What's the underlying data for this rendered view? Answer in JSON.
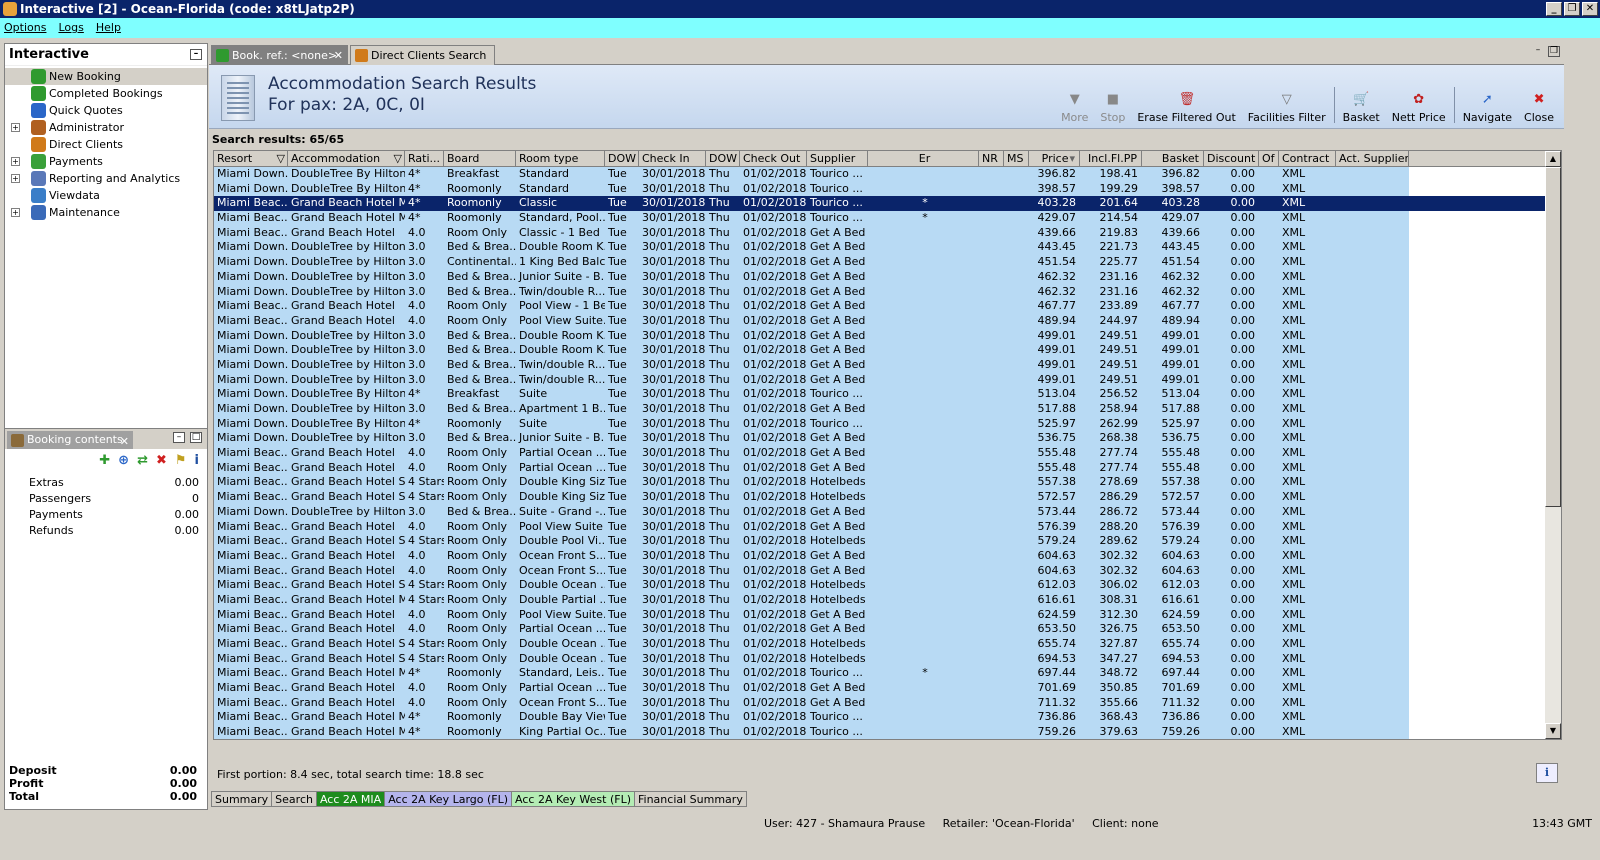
{
  "window": {
    "title": "Interactive [2] - Ocean-Florida (code: x8tLJatp2P)",
    "minimize_icon": "_",
    "restore_icon": "❐",
    "close_icon": "✕"
  },
  "menu": [
    "Options",
    "Logs",
    "Help"
  ],
  "left_panel": {
    "title": "Interactive",
    "items": [
      {
        "label": "New Booking",
        "color": "#2f9a2f",
        "expandable": false,
        "selected": true
      },
      {
        "label": "Completed Bookings",
        "color": "#2f9a2f",
        "expandable": false,
        "selected": false
      },
      {
        "label": "Quick Quotes",
        "color": "#2a66c8",
        "expandable": false,
        "selected": false
      },
      {
        "label": "Administrator",
        "color": "#b06020",
        "expandable": true,
        "selected": false
      },
      {
        "label": "Direct Clients",
        "color": "#d07a1a",
        "expandable": false,
        "selected": false
      },
      {
        "label": "Payments",
        "color": "#3aa03a",
        "expandable": true,
        "selected": false
      },
      {
        "label": "Reporting and Analytics",
        "color": "#5a78b8",
        "expandable": true,
        "selected": false
      },
      {
        "label": "Viewdata",
        "color": "#3a7ec8",
        "expandable": false,
        "selected": false
      },
      {
        "label": "Maintenance",
        "color": "#3a6ab8",
        "expandable": true,
        "selected": false
      }
    ]
  },
  "booking_contents": {
    "tab_label": "Booking contents",
    "tools": [
      "✚",
      "⊕",
      "⇄",
      "✖",
      "⚑",
      "i"
    ],
    "rows": [
      {
        "label": "Extras",
        "value": "0.00"
      },
      {
        "label": "Passengers",
        "value": "0"
      },
      {
        "label": "Payments",
        "value": "0.00"
      },
      {
        "label": "Refunds",
        "value": "0.00"
      }
    ],
    "totals": [
      {
        "label": "Deposit",
        "value": "0.00"
      },
      {
        "label": "Profit",
        "value": "0.00"
      },
      {
        "label": "Total",
        "value": "0.00"
      }
    ]
  },
  "tabs": [
    {
      "label": "Book. ref.: <none>",
      "active": true
    },
    {
      "label": "Direct Clients Search",
      "active": false
    }
  ],
  "header": {
    "title": "Accommodation Search Results",
    "subtitle": "For pax: 2A, 0C, 0I"
  },
  "toolbar": [
    {
      "label": "More",
      "icon": "▼",
      "disabled": true,
      "color": "#888"
    },
    {
      "label": "Stop",
      "icon": "■",
      "disabled": true,
      "color": "#888"
    },
    {
      "label": "Erase Filtered Out",
      "icon": "🗑",
      "disabled": false,
      "color": "#c03030"
    },
    {
      "label": "Facilities Filter",
      "icon": "▽",
      "disabled": false,
      "color": "#777"
    },
    {
      "label": "Basket",
      "icon": "🛒",
      "disabled": false,
      "color": "#c04040",
      "sep_before": true
    },
    {
      "label": "Nett Price",
      "icon": "✿",
      "disabled": false,
      "color": "#c02020"
    },
    {
      "label": "Navigate",
      "icon": "➚",
      "disabled": false,
      "color": "#2a66c8",
      "sep_before": true
    },
    {
      "label": "Close",
      "icon": "✖",
      "disabled": false,
      "color": "#d02020"
    }
  ],
  "results_title": "Search results: 65/65",
  "columns": [
    "Resort",
    "Accommodation",
    "Rati...",
    "Board",
    "Room type",
    "DOW",
    "Check In",
    "DOW",
    "Check Out",
    "Supplier",
    "Er",
    "NR",
    "MS",
    "Price",
    "Incl.Fl.PP",
    "Basket",
    "Discount",
    "Of",
    "Contract",
    "Act. Supplier"
  ],
  "filter_icon": "▽",
  "sort_icon": "▾",
  "rows": [
    [
      "Miami Down...",
      "DoubleTree By Hilton...",
      "4*",
      "Breakfast",
      "Standard",
      "Tue",
      "30/01/2018",
      "Thu",
      "01/02/2018",
      "Tourico ...",
      "",
      "",
      "",
      "396.82",
      "198.41",
      "396.82",
      "0.00",
      "",
      "XML",
      ""
    ],
    [
      "Miami Down...",
      "DoubleTree By Hilton...",
      "4*",
      "Roomonly",
      "Standard",
      "Tue",
      "30/01/2018",
      "Thu",
      "01/02/2018",
      "Tourico ...",
      "",
      "",
      "",
      "398.57",
      "199.29",
      "398.57",
      "0.00",
      "",
      "XML",
      ""
    ],
    [
      "Miami Beac...",
      "Grand Beach Hotel Mi...",
      "4*",
      "Roomonly",
      "Classic",
      "Tue",
      "30/01/2018",
      "Thu",
      "01/02/2018",
      "Tourico ...",
      "*",
      "",
      "",
      "403.28",
      "201.64",
      "403.28",
      "0.00",
      "",
      "XML",
      ""
    ],
    [
      "Miami Beac...",
      "Grand Beach Hotel Mi...",
      "4*",
      "Roomonly",
      "Standard, Pool...",
      "Tue",
      "30/01/2018",
      "Thu",
      "01/02/2018",
      "Tourico ...",
      "*",
      "",
      "",
      "429.07",
      "214.54",
      "429.07",
      "0.00",
      "",
      "XML",
      ""
    ],
    [
      "Miami Beac...",
      "Grand Beach Hotel",
      "4.0",
      "Room Only",
      "Classic - 1 Bed",
      "Tue",
      "30/01/2018",
      "Thu",
      "01/02/2018",
      "Get A Bed",
      "",
      "",
      "",
      "439.66",
      "219.83",
      "439.66",
      "0.00",
      "",
      "XML",
      ""
    ],
    [
      "Miami Down...",
      "DoubleTree by Hilton...",
      "3.0",
      "Bed & Brea...",
      "Double Room K...",
      "Tue",
      "30/01/2018",
      "Thu",
      "01/02/2018",
      "Get A Bed",
      "",
      "",
      "",
      "443.45",
      "221.73",
      "443.45",
      "0.00",
      "",
      "XML",
      ""
    ],
    [
      "Miami Down...",
      "DoubleTree by Hilton...",
      "3.0",
      "Continental...",
      "1 King Bed Balc...",
      "Tue",
      "30/01/2018",
      "Thu",
      "01/02/2018",
      "Get A Bed",
      "",
      "",
      "",
      "451.54",
      "225.77",
      "451.54",
      "0.00",
      "",
      "XML",
      ""
    ],
    [
      "Miami Down...",
      "DoubleTree by Hilton...",
      "3.0",
      "Bed & Brea...",
      "Junior Suite - B...",
      "Tue",
      "30/01/2018",
      "Thu",
      "01/02/2018",
      "Get A Bed",
      "",
      "",
      "",
      "462.32",
      "231.16",
      "462.32",
      "0.00",
      "",
      "XML",
      ""
    ],
    [
      "Miami Down...",
      "DoubleTree by Hilton...",
      "3.0",
      "Bed & Brea...",
      "Twin/double R...",
      "Tue",
      "30/01/2018",
      "Thu",
      "01/02/2018",
      "Get A Bed",
      "",
      "",
      "",
      "462.32",
      "231.16",
      "462.32",
      "0.00",
      "",
      "XML",
      ""
    ],
    [
      "Miami Beac...",
      "Grand Beach Hotel",
      "4.0",
      "Room Only",
      "Pool View - 1 Bed",
      "Tue",
      "30/01/2018",
      "Thu",
      "01/02/2018",
      "Get A Bed",
      "",
      "",
      "",
      "467.77",
      "233.89",
      "467.77",
      "0.00",
      "",
      "XML",
      ""
    ],
    [
      "Miami Beac...",
      "Grand Beach Hotel",
      "4.0",
      "Room Only",
      "Pool View Suite...",
      "Tue",
      "30/01/2018",
      "Thu",
      "01/02/2018",
      "Get A Bed",
      "",
      "",
      "",
      "489.94",
      "244.97",
      "489.94",
      "0.00",
      "",
      "XML",
      ""
    ],
    [
      "Miami Down...",
      "DoubleTree by Hilton...",
      "3.0",
      "Bed & Brea...",
      "Double Room K...",
      "Tue",
      "30/01/2018",
      "Thu",
      "01/02/2018",
      "Get A Bed",
      "",
      "",
      "",
      "499.01",
      "249.51",
      "499.01",
      "0.00",
      "",
      "XML",
      ""
    ],
    [
      "Miami Down...",
      "DoubleTree by Hilton...",
      "3.0",
      "Bed & Brea...",
      "Double Room K...",
      "Tue",
      "30/01/2018",
      "Thu",
      "01/02/2018",
      "Get A Bed",
      "",
      "",
      "",
      "499.01",
      "249.51",
      "499.01",
      "0.00",
      "",
      "XML",
      ""
    ],
    [
      "Miami Down...",
      "DoubleTree by Hilton...",
      "3.0",
      "Bed & Brea...",
      "Twin/double R...",
      "Tue",
      "30/01/2018",
      "Thu",
      "01/02/2018",
      "Get A Bed",
      "",
      "",
      "",
      "499.01",
      "249.51",
      "499.01",
      "0.00",
      "",
      "XML",
      ""
    ],
    [
      "Miami Down...",
      "DoubleTree by Hilton...",
      "3.0",
      "Bed & Brea...",
      "Twin/double R...",
      "Tue",
      "30/01/2018",
      "Thu",
      "01/02/2018",
      "Get A Bed",
      "",
      "",
      "",
      "499.01",
      "249.51",
      "499.01",
      "0.00",
      "",
      "XML",
      ""
    ],
    [
      "Miami Down...",
      "DoubleTree By Hilton...",
      "4*",
      "Breakfast",
      "Suite",
      "Tue",
      "30/01/2018",
      "Thu",
      "01/02/2018",
      "Tourico ...",
      "",
      "",
      "",
      "513.04",
      "256.52",
      "513.04",
      "0.00",
      "",
      "XML",
      ""
    ],
    [
      "Miami Down...",
      "DoubleTree by Hilton...",
      "3.0",
      "Bed & Brea...",
      "Apartment 1 B...",
      "Tue",
      "30/01/2018",
      "Thu",
      "01/02/2018",
      "Get A Bed",
      "",
      "",
      "",
      "517.88",
      "258.94",
      "517.88",
      "0.00",
      "",
      "XML",
      ""
    ],
    [
      "Miami Down...",
      "DoubleTree By Hilton...",
      "4*",
      "Roomonly",
      "Suite",
      "Tue",
      "30/01/2018",
      "Thu",
      "01/02/2018",
      "Tourico ...",
      "",
      "",
      "",
      "525.97",
      "262.99",
      "525.97",
      "0.00",
      "",
      "XML",
      ""
    ],
    [
      "Miami Down...",
      "DoubleTree by Hilton...",
      "3.0",
      "Bed & Brea...",
      "Junior Suite - B...",
      "Tue",
      "30/01/2018",
      "Thu",
      "01/02/2018",
      "Get A Bed",
      "",
      "",
      "",
      "536.75",
      "268.38",
      "536.75",
      "0.00",
      "",
      "XML",
      ""
    ],
    [
      "Miami Beac...",
      "Grand Beach Hotel",
      "4.0",
      "Room Only",
      "Partial Ocean ...",
      "Tue",
      "30/01/2018",
      "Thu",
      "01/02/2018",
      "Get A Bed",
      "",
      "",
      "",
      "555.48",
      "277.74",
      "555.48",
      "0.00",
      "",
      "XML",
      ""
    ],
    [
      "Miami Beac...",
      "Grand Beach Hotel",
      "4.0",
      "Room Only",
      "Partial Ocean ...",
      "Tue",
      "30/01/2018",
      "Thu",
      "01/02/2018",
      "Get A Bed",
      "",
      "",
      "",
      "555.48",
      "277.74",
      "555.48",
      "0.00",
      "",
      "XML",
      ""
    ],
    [
      "Miami Beac...",
      "Grand Beach Hotel S...",
      "4 Stars",
      "Room Only",
      "Double King Siz...",
      "Tue",
      "30/01/2018",
      "Thu",
      "01/02/2018",
      "Hotelbeds",
      "",
      "",
      "",
      "557.38",
      "278.69",
      "557.38",
      "0.00",
      "",
      "XML",
      ""
    ],
    [
      "Miami Beac...",
      "Grand Beach Hotel S...",
      "4 Stars",
      "Room Only",
      "Double King Siz...",
      "Tue",
      "30/01/2018",
      "Thu",
      "01/02/2018",
      "Hotelbeds",
      "",
      "",
      "",
      "572.57",
      "286.29",
      "572.57",
      "0.00",
      "",
      "XML",
      ""
    ],
    [
      "Miami Down...",
      "DoubleTree by Hilton...",
      "3.0",
      "Bed & Brea...",
      "Suite - Grand -...",
      "Tue",
      "30/01/2018",
      "Thu",
      "01/02/2018",
      "Get A Bed",
      "",
      "",
      "",
      "573.44",
      "286.72",
      "573.44",
      "0.00",
      "",
      "XML",
      ""
    ],
    [
      "Miami Beac...",
      "Grand Beach Hotel",
      "4.0",
      "Room Only",
      "Pool View Suite",
      "Tue",
      "30/01/2018",
      "Thu",
      "01/02/2018",
      "Get A Bed",
      "",
      "",
      "",
      "576.39",
      "288.20",
      "576.39",
      "0.00",
      "",
      "XML",
      ""
    ],
    [
      "Miami Beac...",
      "Grand Beach Hotel S...",
      "4 Stars",
      "Room Only",
      "Double Pool Vi...",
      "Tue",
      "30/01/2018",
      "Thu",
      "01/02/2018",
      "Hotelbeds",
      "",
      "",
      "",
      "579.24",
      "289.62",
      "579.24",
      "0.00",
      "",
      "XML",
      ""
    ],
    [
      "Miami Beac...",
      "Grand Beach Hotel",
      "4.0",
      "Room Only",
      "Ocean Front S...",
      "Tue",
      "30/01/2018",
      "Thu",
      "01/02/2018",
      "Get A Bed",
      "",
      "",
      "",
      "604.63",
      "302.32",
      "604.63",
      "0.00",
      "",
      "XML",
      ""
    ],
    [
      "Miami Beac...",
      "Grand Beach Hotel",
      "4.0",
      "Room Only",
      "Ocean Front S...",
      "Tue",
      "30/01/2018",
      "Thu",
      "01/02/2018",
      "Get A Bed",
      "",
      "",
      "",
      "604.63",
      "302.32",
      "604.63",
      "0.00",
      "",
      "XML",
      ""
    ],
    [
      "Miami Beac...",
      "Grand Beach Hotel S...",
      "4 Stars",
      "Room Only",
      "Double Ocean ...",
      "Tue",
      "30/01/2018",
      "Thu",
      "01/02/2018",
      "Hotelbeds",
      "",
      "",
      "",
      "612.03",
      "306.02",
      "612.03",
      "0.00",
      "",
      "XML",
      ""
    ],
    [
      "Miami Beac...",
      "Grand Beach Hotel Mi...",
      "4 Stars",
      "Room Only",
      "Double Partial ...",
      "Tue",
      "30/01/2018",
      "Thu",
      "01/02/2018",
      "Hotelbeds",
      "",
      "",
      "",
      "616.61",
      "308.31",
      "616.61",
      "0.00",
      "",
      "XML",
      ""
    ],
    [
      "Miami Beac...",
      "Grand Beach Hotel",
      "4.0",
      "Room Only",
      "Pool View Suite...",
      "Tue",
      "30/01/2018",
      "Thu",
      "01/02/2018",
      "Get A Bed",
      "",
      "",
      "",
      "624.59",
      "312.30",
      "624.59",
      "0.00",
      "",
      "XML",
      ""
    ],
    [
      "Miami Beac...",
      "Grand Beach Hotel",
      "4.0",
      "Room Only",
      "Partial Ocean ...",
      "Tue",
      "30/01/2018",
      "Thu",
      "01/02/2018",
      "Get A Bed",
      "",
      "",
      "",
      "653.50",
      "326.75",
      "653.50",
      "0.00",
      "",
      "XML",
      ""
    ],
    [
      "Miami Beac...",
      "Grand Beach Hotel S...",
      "4 Stars",
      "Room Only",
      "Double Ocean ...",
      "Tue",
      "30/01/2018",
      "Thu",
      "01/02/2018",
      "Hotelbeds",
      "",
      "",
      "",
      "655.74",
      "327.87",
      "655.74",
      "0.00",
      "",
      "XML",
      ""
    ],
    [
      "Miami Beac...",
      "Grand Beach Hotel S...",
      "4 Stars",
      "Room Only",
      "Double Ocean ...",
      "Tue",
      "30/01/2018",
      "Thu",
      "01/02/2018",
      "Hotelbeds",
      "",
      "",
      "",
      "694.53",
      "347.27",
      "694.53",
      "0.00",
      "",
      "XML",
      ""
    ],
    [
      "Miami Beac...",
      "Grand Beach Hotel Mi...",
      "4*",
      "Roomonly",
      "Standard, Leis...",
      "Tue",
      "30/01/2018",
      "Thu",
      "01/02/2018",
      "Tourico ...",
      "*",
      "",
      "",
      "697.44",
      "348.72",
      "697.44",
      "0.00",
      "",
      "XML",
      ""
    ],
    [
      "Miami Beac...",
      "Grand Beach Hotel",
      "4.0",
      "Room Only",
      "Partial Ocean ...",
      "Tue",
      "30/01/2018",
      "Thu",
      "01/02/2018",
      "Get A Bed",
      "",
      "",
      "",
      "701.69",
      "350.85",
      "701.69",
      "0.00",
      "",
      "XML",
      ""
    ],
    [
      "Miami Beac...",
      "Grand Beach Hotel",
      "4.0",
      "Room Only",
      "Ocean Front S...",
      "Tue",
      "30/01/2018",
      "Thu",
      "01/02/2018",
      "Get A Bed",
      "",
      "",
      "",
      "711.32",
      "355.66",
      "711.32",
      "0.00",
      "",
      "XML",
      ""
    ],
    [
      "Miami Beac...",
      "Grand Beach Hotel Mi...",
      "4*",
      "Roomonly",
      "Double Bay View",
      "Tue",
      "30/01/2018",
      "Thu",
      "01/02/2018",
      "Tourico ...",
      "",
      "",
      "",
      "736.86",
      "368.43",
      "736.86",
      "0.00",
      "",
      "XML",
      ""
    ],
    [
      "Miami Beac...",
      "Grand Beach Hotel Mi...",
      "4*",
      "Roomonly",
      "King Partial Oc...",
      "Tue",
      "30/01/2018",
      "Thu",
      "01/02/2018",
      "Tourico ...",
      "",
      "",
      "",
      "759.26",
      "379.63",
      "759.26",
      "0.00",
      "",
      "XML",
      ""
    ]
  ],
  "selected_row": 2,
  "search_time": "First portion: 8.4 sec, total search time: 18.8 sec",
  "info_button": "i",
  "bottom_tabs": [
    {
      "label": "Summary",
      "bg": "#d4d0c8",
      "fg": "#000"
    },
    {
      "label": "Search",
      "bg": "#d4d0c8",
      "fg": "#000"
    },
    {
      "label": "Acc 2A MIA",
      "bg": "#1e8c1e",
      "fg": "#fff"
    },
    {
      "label": "Acc 2A Key Largo (FL)",
      "bg": "#b4b4ec",
      "fg": "#000"
    },
    {
      "label": "Acc 2A Key West (FL)",
      "bg": "#b4ecb4",
      "fg": "#000"
    },
    {
      "label": "Financial Summary",
      "bg": "#d4d0c8",
      "fg": "#000"
    }
  ],
  "status": {
    "user": "User: 427 - Shamaura Prause",
    "retailer": "Retailer: 'Ocean-Florida'",
    "client": "Client: none",
    "time": "13:43 GMT"
  },
  "colors": {
    "row_bg": "#b8daf4",
    "selected_bg": "#0a246a",
    "title_bg": "#0a246a",
    "menu_bg": "#7fffff"
  }
}
